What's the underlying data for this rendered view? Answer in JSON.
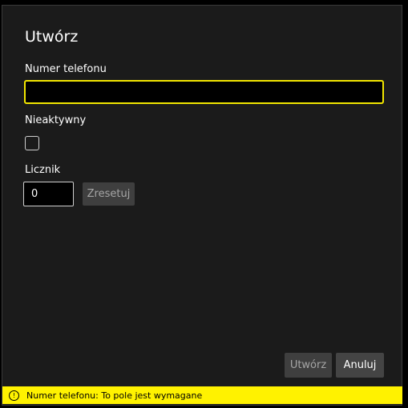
{
  "dialog": {
    "title": "Utwórz",
    "phone": {
      "label": "Numer telefonu",
      "value": ""
    },
    "inactive": {
      "label": "Nieaktywny",
      "checked": false
    },
    "counter": {
      "label": "Licznik",
      "value": "0",
      "reset_label": "Zresetuj"
    },
    "buttons": {
      "create_label": "Utwórz",
      "cancel_label": "Anuluj"
    }
  },
  "validation": {
    "icon_glyph": "!",
    "message": "Numer telefonu: To pole jest wymagane",
    "color": "#fff200"
  },
  "colors": {
    "focus_border": "#f2e600",
    "background": "#1b1b1b"
  }
}
